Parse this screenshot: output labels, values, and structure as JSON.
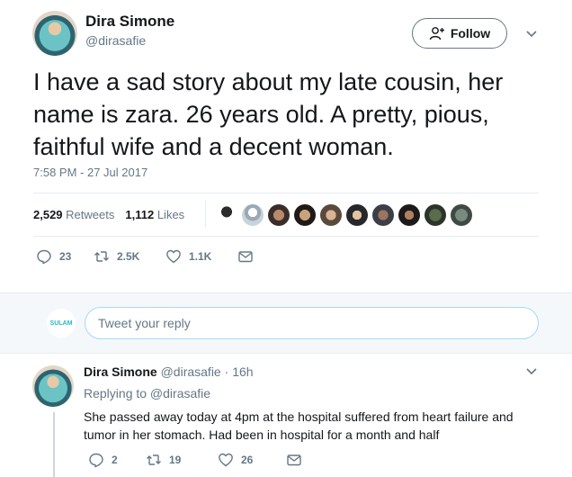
{
  "tweet": {
    "author_name": "Dira Simone",
    "author_handle": "@dirasafie",
    "follow_label": "Follow",
    "text": "I have a sad story about my late cousin, her name is zara. 26 years old. A pretty, pious, faithful wife and a decent woman.",
    "timestamp": "7:58 PM - 27 Jul 2017",
    "retweets_count": "2,529",
    "retweets_label": "Retweets",
    "likes_count": "1,112",
    "likes_label": "Likes",
    "actions": {
      "replies": "23",
      "retweets": "2.5K",
      "likes": "1.1K"
    }
  },
  "reply_box": {
    "avatar_text": "SULAM",
    "placeholder": "Tweet your reply"
  },
  "reply": {
    "author_name": "Dira Simone",
    "author_handle": "@dirasafie",
    "separator": "·",
    "time": "16h",
    "replying_to": "Replying to @dirasafie",
    "text": "She passed away today at 4pm at the hospital suffered from heart failure and tumor in her stomach. Had been in hospital for a month and half",
    "actions": {
      "replies": "2",
      "retweets": "19",
      "likes": "26"
    }
  },
  "icons": [
    "follow-person-icon",
    "chevron-down-icon",
    "reply-icon",
    "retweet-icon",
    "like-icon",
    "direct-message-icon"
  ],
  "colors": {
    "text": "#14171a",
    "muted": "#657786",
    "border": "#e6ecf0",
    "band": "#f5f8fa",
    "input_border": "#a4d9f9"
  }
}
